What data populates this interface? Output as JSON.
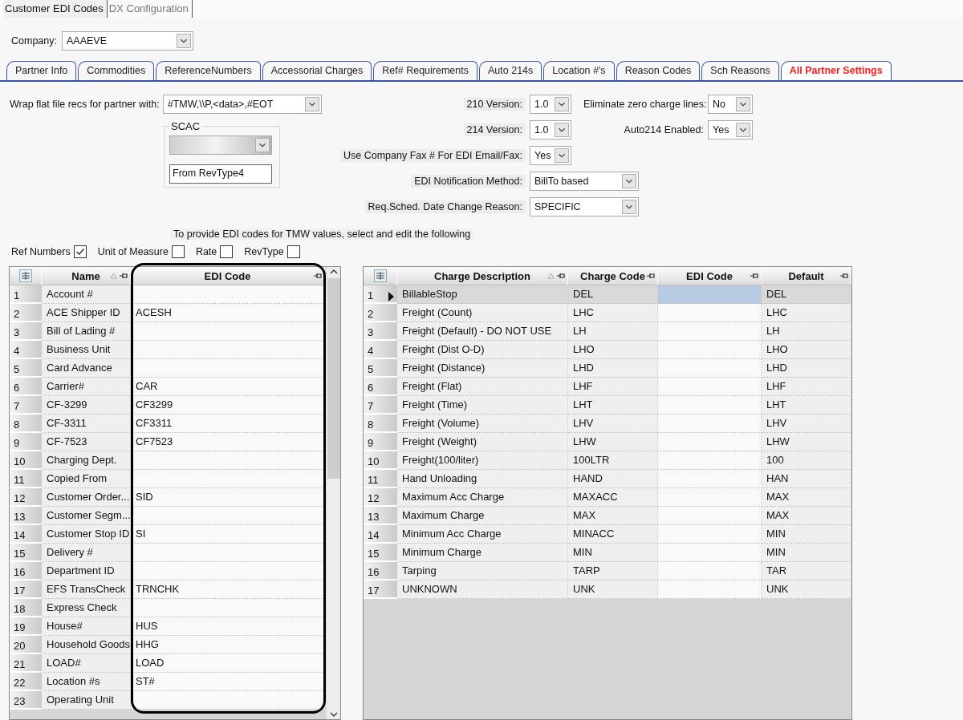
{
  "top_tabs": [
    {
      "label": "Customer EDI Codes",
      "selected": true
    },
    {
      "label": "DX Configuration",
      "selected": false
    }
  ],
  "company": {
    "label": "Company:",
    "value": "AAAEVE"
  },
  "tabs": [
    {
      "label": "Partner Info",
      "selected": false
    },
    {
      "label": "Commodities",
      "selected": false
    },
    {
      "label": "ReferenceNumbers",
      "selected": false
    },
    {
      "label": "Accessorial Charges",
      "selected": false
    },
    {
      "label": "Ref# Requirements",
      "selected": false
    },
    {
      "label": "Auto 214s",
      "selected": false
    },
    {
      "label": "Location #'s",
      "selected": false
    },
    {
      "label": "Reason Codes",
      "selected": false
    },
    {
      "label": "Sch Reasons",
      "selected": false
    },
    {
      "label": "All Partner Settings",
      "selected": true
    }
  ],
  "wrap": {
    "label": "Wrap flat file recs for partner with:",
    "value": "#TMW,\\\\P,<data>,#EOT"
  },
  "scac": {
    "title": "SCAC",
    "dropdown_disabled": true,
    "value": "From RevType4"
  },
  "fields": [
    {
      "label": "210 Version:",
      "value": "1.0",
      "kind": "short",
      "side": {
        "label": "Eliminate zero charge lines:",
        "value": "No"
      }
    },
    {
      "label": "214 Version:",
      "value": "1.0",
      "kind": "short",
      "side": {
        "label": "Auto214 Enabled:",
        "value": "Yes"
      }
    },
    {
      "label": "Use Company Fax # For EDI Email/Fax:",
      "value": "Yes",
      "kind": "short"
    },
    {
      "label": "EDI Notification Method:",
      "value": "BillTo based",
      "kind": "wide"
    },
    {
      "label": "Req.Sched. Date Change Reason:",
      "value": "SPECIFIC",
      "kind": "wide"
    }
  ],
  "hint": "To provide EDI codes for TMW values, select and edit the following",
  "filters": [
    {
      "label": "Ref Numbers",
      "checked": true
    },
    {
      "label": "Unit of Measure",
      "checked": false
    },
    {
      "label": "Rate",
      "checked": false
    },
    {
      "label": "RevType",
      "checked": false
    }
  ],
  "ref_grid": {
    "columns": [
      "Name",
      "EDI Code"
    ],
    "rows": [
      {
        "n": "1",
        "name": "Account #"
      },
      {
        "n": "2",
        "name": "ACE Shipper ID",
        "edi_code": "ACESH"
      },
      {
        "n": "3",
        "name": "Bill of Lading #"
      },
      {
        "n": "4",
        "name": "Business Unit"
      },
      {
        "n": "5",
        "name": "Card Advance"
      },
      {
        "n": "6",
        "name": "Carrier#",
        "edi_code": "CAR"
      },
      {
        "n": "7",
        "name": "CF-3299",
        "edi_code": "CF3299"
      },
      {
        "n": "8",
        "name": "CF-3311",
        "edi_code": "CF3311"
      },
      {
        "n": "9",
        "name": "CF-7523",
        "edi_code": "CF7523"
      },
      {
        "n": "10",
        "name": "Charging Dept."
      },
      {
        "n": "11",
        "name": "Copied From"
      },
      {
        "n": "12",
        "name": "Customer Order...",
        "edi_code": "SID"
      },
      {
        "n": "13",
        "name": "Customer Segm..."
      },
      {
        "n": "14",
        "name": "Customer Stop ID",
        "edi_code": "SI"
      },
      {
        "n": "15",
        "name": "Delivery #"
      },
      {
        "n": "16",
        "name": "Department ID"
      },
      {
        "n": "17",
        "name": "EFS TransCheck",
        "edi_code": "TRNCHK"
      },
      {
        "n": "18",
        "name": "Express Check"
      },
      {
        "n": "19",
        "name": "House#",
        "edi_code": "HUS"
      },
      {
        "n": "20",
        "name": "Household Goods",
        "edi_code": "HHG"
      },
      {
        "n": "21",
        "name": "LOAD#",
        "edi_code": "LOAD"
      },
      {
        "n": "22",
        "name": "Location #s",
        "edi_code": "ST#"
      },
      {
        "n": "23",
        "name": "Operating Unit"
      }
    ]
  },
  "charge_grid": {
    "columns": [
      "Charge Description",
      "Charge Code",
      "EDI Code",
      "Default"
    ],
    "rows": [
      {
        "n": "1",
        "description": "BillableStop",
        "charge_code": "DEL",
        "default": "DEL",
        "selected": true
      },
      {
        "n": "2",
        "description": "Freight (Count)",
        "charge_code": "LHC",
        "default": "LHC",
        "selected": false
      },
      {
        "n": "3",
        "description": "Freight (Default) - DO NOT USE",
        "charge_code": "LH",
        "default": "LH",
        "selected": false
      },
      {
        "n": "4",
        "description": "Freight (Dist O-D)",
        "charge_code": "LHO",
        "default": "LHO",
        "selected": false
      },
      {
        "n": "5",
        "description": "Freight (Distance)",
        "charge_code": "LHD",
        "default": "LHD",
        "selected": false
      },
      {
        "n": "6",
        "description": "Freight (Flat)",
        "charge_code": "LHF",
        "default": "LHF",
        "selected": false
      },
      {
        "n": "7",
        "description": "Freight (Time)",
        "charge_code": "LHT",
        "default": "LHT",
        "selected": false
      },
      {
        "n": "8",
        "description": "Freight (Volume)",
        "charge_code": "LHV",
        "default": "LHV",
        "selected": false
      },
      {
        "n": "9",
        "description": "Freight (Weight)",
        "charge_code": "LHW",
        "default": "LHW",
        "selected": false
      },
      {
        "n": "10",
        "description": "Freight(100/liter)",
        "charge_code": "100LTR",
        "default": "100",
        "selected": false
      },
      {
        "n": "11",
        "description": "Hand Unloading",
        "charge_code": "HAND",
        "default": "HAN",
        "selected": false
      },
      {
        "n": "12",
        "description": "Maximum Acc Charge",
        "charge_code": "MAXACC",
        "default": "MAX",
        "selected": false
      },
      {
        "n": "13",
        "description": "Maximum Charge",
        "charge_code": "MAX",
        "default": "MAX",
        "selected": false
      },
      {
        "n": "14",
        "description": "Minimum Acc Charge",
        "charge_code": "MINACC",
        "default": "MIN",
        "selected": false
      },
      {
        "n": "15",
        "description": "Minimum Charge",
        "charge_code": "MIN",
        "default": "MIN",
        "selected": false
      },
      {
        "n": "16",
        "description": "Tarping",
        "charge_code": "TARP",
        "default": "TAR",
        "selected": false
      },
      {
        "n": "17",
        "description": "UNKNOWN",
        "charge_code": "UNK",
        "default": "UNK",
        "selected": false
      }
    ]
  }
}
